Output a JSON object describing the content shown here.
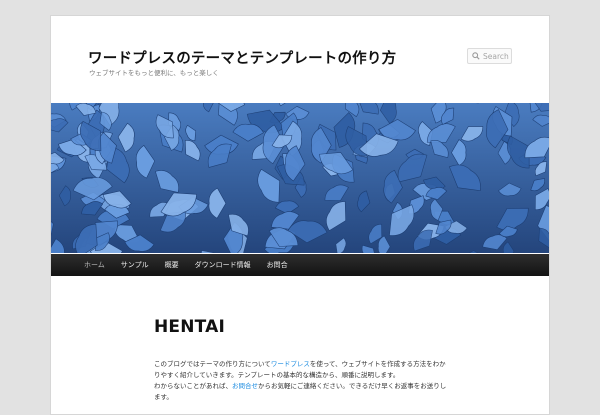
{
  "site": {
    "title": "ワードプレスのテーマとテンプレートの作り方",
    "description": "ウェブサイトをもっと便利に、もっと楽しく"
  },
  "search": {
    "placeholder": "Search"
  },
  "nav": {
    "items": [
      {
        "label": "ホーム",
        "current": true
      },
      {
        "label": "サンプル"
      },
      {
        "label": "概要"
      },
      {
        "label": "ダウンロード情報"
      },
      {
        "label": "お問合"
      }
    ]
  },
  "post": {
    "title": "HENTAI",
    "paragraph1_before": "このブログではテーマの作り方について",
    "paragraph1_link": "ワードプレス",
    "paragraph1_after": "を使って、ウェブサイトを作成する方法をわかりやすく紹介していきます。テンプレートの基本的な構造から、",
    "paragraph1_end": "順番に説明します。",
    "paragraph2_before": "わからないことがあれば、",
    "paragraph2_link": "お問合せ",
    "paragraph2_after": "からお気軽にご連絡ください。できるだけ早くお返事をお送りします。"
  },
  "colors": {
    "page_bg": "#e2e2e2",
    "content_bg": "#ffffff",
    "nav_bg": "#1f1f1f",
    "link": "#1b8be0",
    "header_image_main": "#3f6fb0"
  },
  "icons": {
    "search": "magnifier-icon"
  }
}
